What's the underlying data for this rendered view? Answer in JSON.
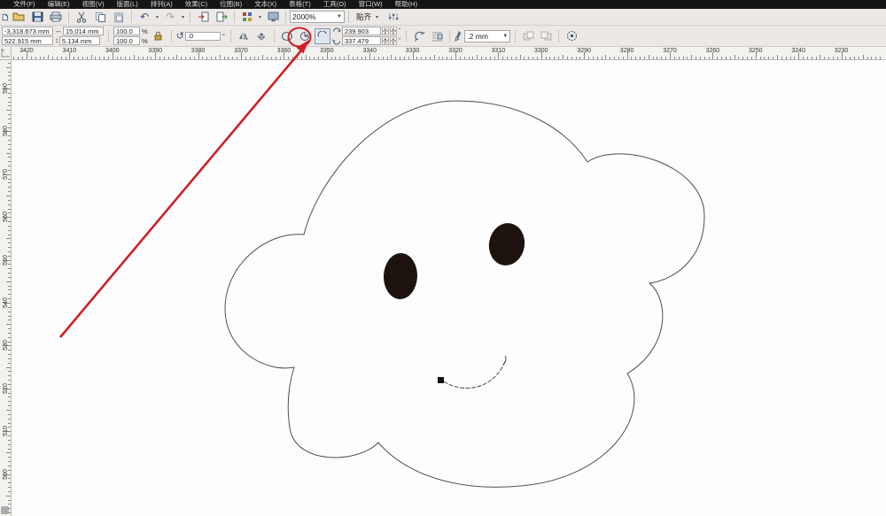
{
  "menu": {
    "items": [
      "文件(F)",
      "编辑(E)",
      "视图(V)",
      "版面(L)",
      "排列(A)",
      "效果(C)",
      "位图(B)",
      "文本(X)",
      "表格(T)",
      "工具(O)",
      "窗口(W)",
      "帮助(H)"
    ]
  },
  "toolbar": {
    "zoom_level": "2000%",
    "snap_label": "贴齐",
    "icons": [
      "new",
      "open",
      "save",
      "print",
      "cut",
      "copy",
      "paste",
      "undo",
      "redo",
      "import",
      "export",
      "app-launcher",
      "welcome-screen",
      "zoom-combo",
      "snap-dropdown",
      "options"
    ]
  },
  "propertybar": {
    "pos_x": "-3,318.673 mm",
    "pos_y": "522.915 mm",
    "size_w": "15.014 mm",
    "size_h": "5.134 mm",
    "scale_x": "100.0",
    "scale_y": "100.0",
    "pct": "%",
    "angle": ".0",
    "deg": "°",
    "start_angle": "239.903",
    "end_angle": "337.479",
    "outline_width": ".2 mm",
    "shape_buttons": [
      "ellipse",
      "pie",
      "arc"
    ],
    "active_shape": "arc"
  },
  "rulers": {
    "h_labels": [
      "3420",
      "3410",
      "3400",
      "3390",
      "3380",
      "3370",
      "3360",
      "3350",
      "3340",
      "3330",
      "3320",
      "3310",
      "3300",
      "3290",
      "3280",
      "3270",
      "3260",
      "3250",
      "3240",
      "3230"
    ],
    "v_labels": [
      "590",
      "580",
      "570",
      "560",
      "550",
      "540",
      "530",
      "520",
      "510",
      "500"
    ],
    "h_start": 17,
    "v_start": 32,
    "step": 48.4
  },
  "colors": {
    "annotation_red": "#cf2027",
    "outline_ink": "#4f4f4f",
    "eye_fill": "#1c130e"
  },
  "drawing": {
    "shapes": [
      "cloud-face-outline",
      "left-eye",
      "right-eye",
      "smile-curve",
      "smile-node"
    ],
    "annotation": "red-arrow-pointing-to-arc-button"
  }
}
